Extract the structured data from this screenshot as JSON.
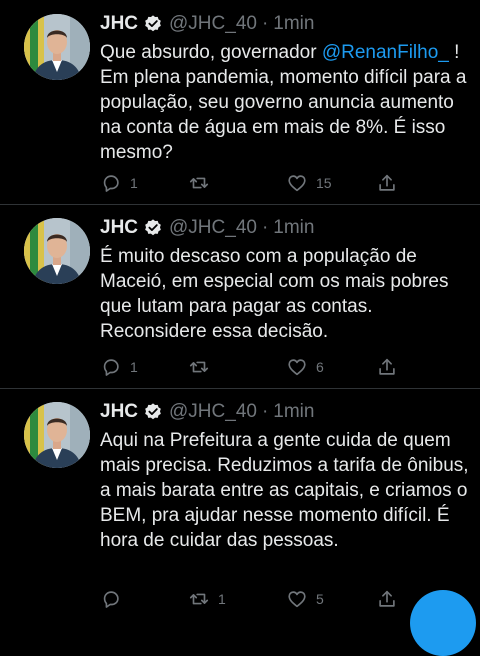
{
  "tweets": [
    {
      "author_name": "JHC",
      "handle": "@JHC_40",
      "separator": "·",
      "time": "1min",
      "text_before": "Que absurdo, governador ",
      "mention": "@RenanFilho_",
      "text_after": " ! Em plena pandemia, momento difícil para a população, seu governo anuncia aumento na conta de água em mais de 8%. É isso mesmo?",
      "replies": "1",
      "retweets": "",
      "likes": "15"
    },
    {
      "author_name": "JHC",
      "handle": "@JHC_40",
      "separator": "·",
      "time": "1min",
      "text": "É muito descaso com a população de Maceió, em especial com os mais pobres que lutam para pagar as contas. Reconsidere essa decisão.",
      "replies": "1",
      "retweets": "",
      "likes": "6"
    },
    {
      "author_name": "JHC",
      "handle": "@JHC_40",
      "separator": "·",
      "time": "1min",
      "text": "Aqui na Prefeitura a gente cuida de quem mais precisa. Reduzimos a tarifa de ônibus, a mais barata entre as capitais, e criamos o BEM, pra ajudar nesse momento difícil. É hora de cuidar das pessoas.",
      "replies": "",
      "retweets": "1",
      "likes": "5"
    }
  ],
  "icons": {
    "verified": "verified-badge-icon",
    "reply": "reply-icon",
    "retweet": "retweet-icon",
    "like": "heart-icon",
    "share": "share-icon"
  },
  "colors": {
    "background": "#000000",
    "text": "#e7e9ea",
    "secondary": "#71767b",
    "accent": "#1d9bf0",
    "divider": "#2f3336"
  }
}
